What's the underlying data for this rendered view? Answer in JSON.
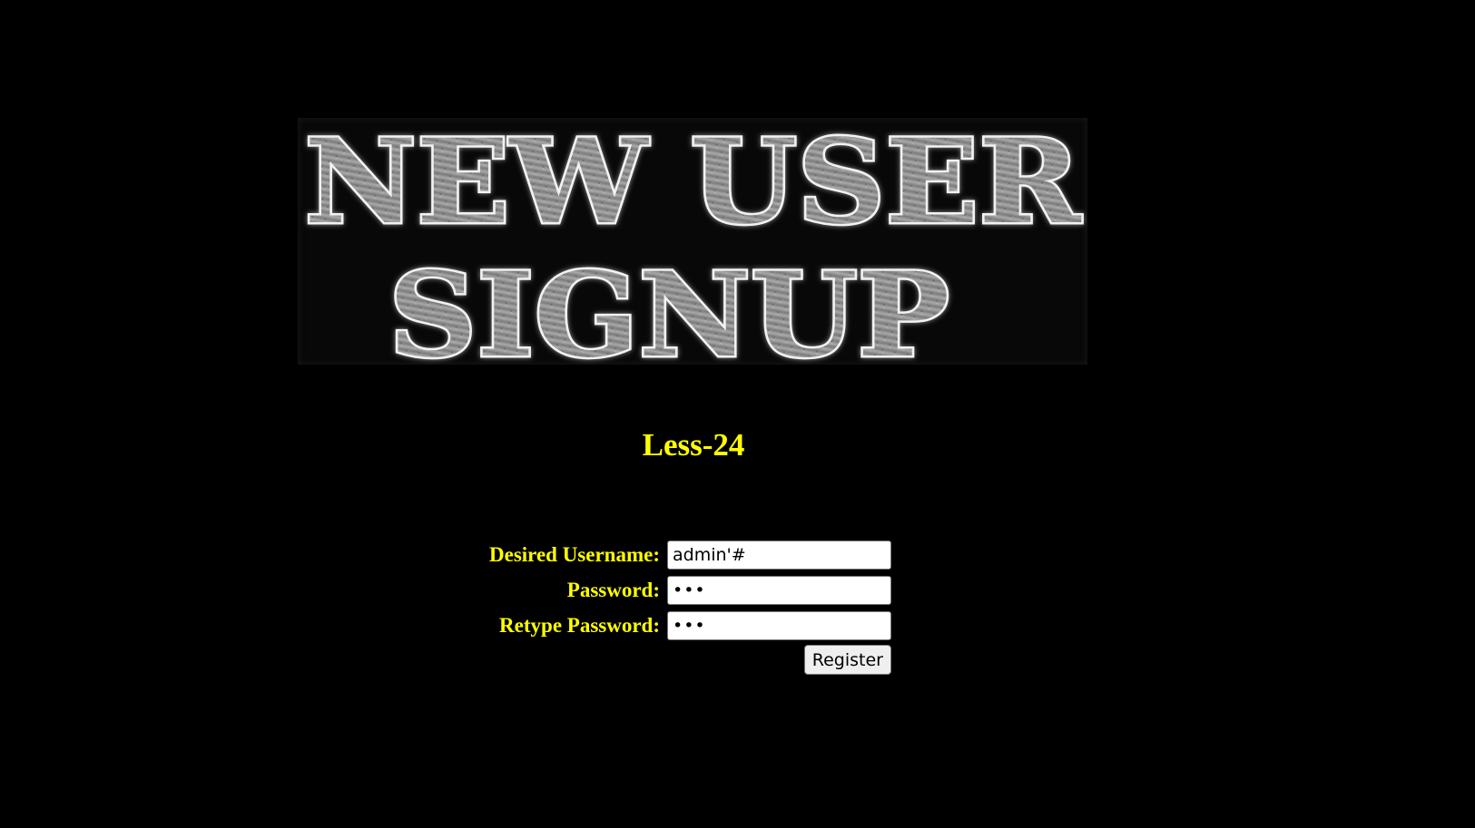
{
  "banner": {
    "line1": "NEW USER",
    "line2": "SIGNUP"
  },
  "lesson_title": "Less-24",
  "form": {
    "username_label": "Desired Username:",
    "username_value": "admin'#",
    "password_label": "Password:",
    "password_value": "abc",
    "retype_label": "Retype Password:",
    "retype_value": "abc",
    "register_label": "Register"
  },
  "colors": {
    "background": "#000000",
    "label_text": "#ffff00",
    "banner_fill": "#8a8a8a"
  }
}
